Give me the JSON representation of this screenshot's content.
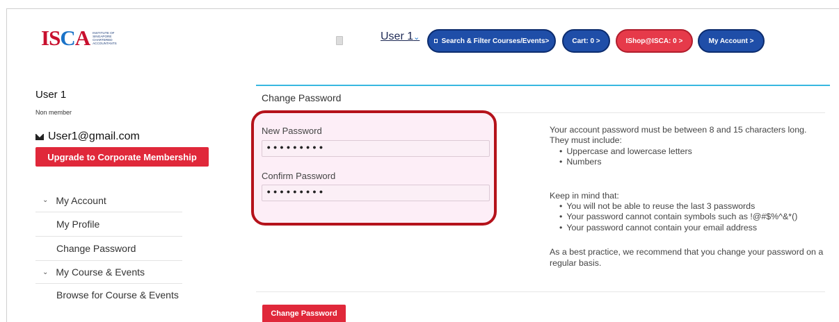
{
  "header": {
    "logo_text": "ISCA",
    "logo_subtitle": "Institute of Singapore Chartered Accountants",
    "user_label": "User 1",
    "buttons": {
      "search": "Search & Filter Courses/Events>",
      "cart": "Cart: 0 >",
      "ishop": "IShop@ISCA: 0 >",
      "account": "My Account >"
    }
  },
  "sidebar": {
    "user_name": "User 1",
    "membership": "Non member",
    "email": "User1@gmail.com",
    "upgrade_label": "Upgrade to Corporate Membership",
    "groups": [
      {
        "label": "My Account",
        "items": [
          "My Profile",
          "Change Password"
        ]
      },
      {
        "label": "My Course & Events",
        "items": [
          "Browse for Course & Events"
        ]
      }
    ]
  },
  "panel": {
    "title": "Change Password",
    "new_password_label": "New Password",
    "new_password_value": "•••••••••",
    "confirm_password_label": "Confirm Password",
    "confirm_password_value": "•••••••••",
    "submit_label": "Change Password"
  },
  "info": {
    "intro": "Your account password must be between 8 and 15 characters long. They must include:",
    "must_include": [
      "Uppercase and lowercase letters",
      "Numbers"
    ],
    "keep_in_mind": "Keep in mind that:",
    "rules": [
      "You will not be able to reuse the last 3 passwords",
      "Your password cannot contain symbols such as !@#$%^&*()",
      "Your password cannot contain your email address"
    ],
    "best_practice": "As a best practice, we recommend that you change your password on a regular basis."
  },
  "colors": {
    "brand_red": "#e0283a",
    "nav_blue": "#1f4ea8",
    "highlight_border": "#b5121b",
    "panel_accent": "#38b7e0"
  }
}
